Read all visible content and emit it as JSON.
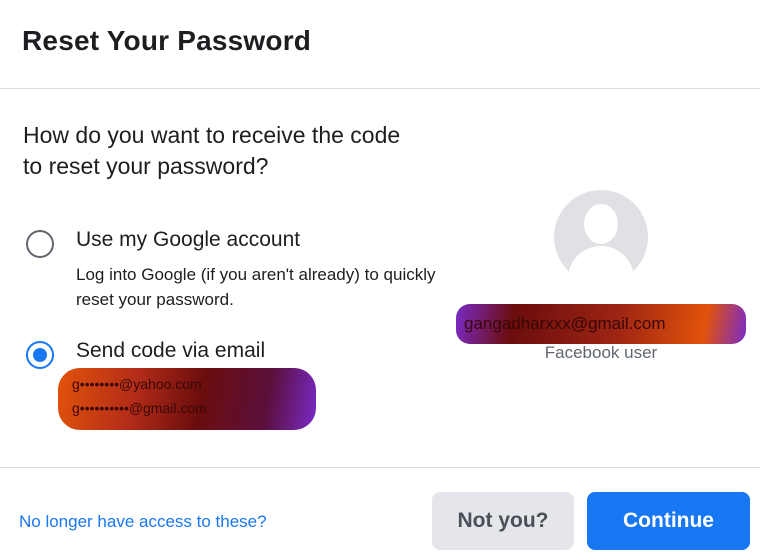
{
  "dialog": {
    "title": "Reset Your Password"
  },
  "question": "How do you want to receive the code to reset your password?",
  "options": [
    {
      "label": "Use my Google account",
      "description": "Log into Google (if you aren't already) to quickly reset your password.",
      "selected": false
    },
    {
      "label": "Send code via email",
      "emails": [
        "g••••••••@yahoo.com",
        "g••••••••••@gmail.com"
      ],
      "selected": true
    }
  ],
  "profile": {
    "email": "gangadharxxx@gmail.com",
    "subtitle": "Facebook user"
  },
  "footer": {
    "link": "No longer have access to these?",
    "secondary_button": "Not you?",
    "primary_button": "Continue"
  },
  "colors": {
    "accent": "#1877f2",
    "secondary_button_bg": "#e4e6eb",
    "redaction_orange": "#e2530a",
    "redaction_maroon": "#6b0d0d",
    "redaction_purple": "#7a2ac8"
  }
}
